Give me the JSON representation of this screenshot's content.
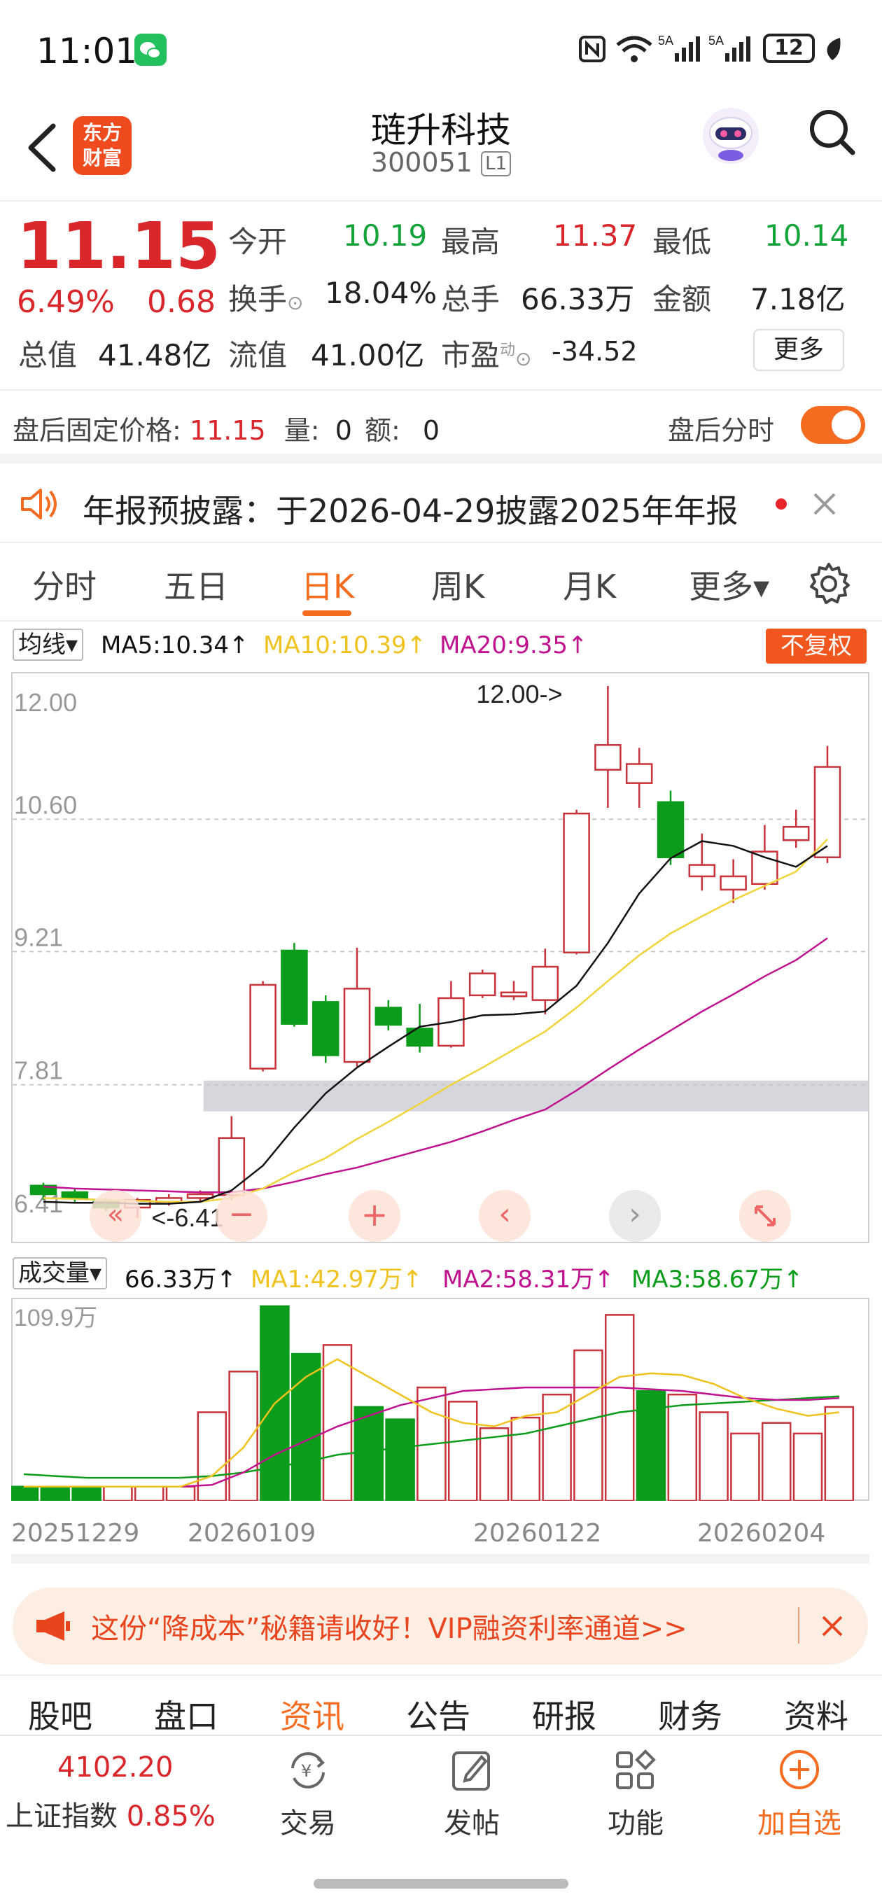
{
  "status_bar": {
    "time": "11:01",
    "battery": "12"
  },
  "header": {
    "title": "琏升科技",
    "code": "300051",
    "level": "L1",
    "logo_line1": "东方",
    "logo_line2": "财富"
  },
  "quote": {
    "price": "11.15",
    "change_pct": "6.49%",
    "change_amt": "0.68",
    "open_label": "今开",
    "open": "10.19",
    "high_label": "最高",
    "high": "11.37",
    "low_label": "最低",
    "low": "10.14",
    "turnover_label": "换手",
    "turnover": "18.04%",
    "volume_label": "总手",
    "volume": "66.33万",
    "amount_label": "金额",
    "amount": "7.18亿",
    "mktcap_label": "总值",
    "mktcap": "41.48亿",
    "float_label": "流值",
    "float_cap": "41.00亿",
    "pe_label": "市盈",
    "pe_sup": "动",
    "pe": "-34.52",
    "more_button": "更多"
  },
  "after_hours": {
    "label": "盘后固定价格:",
    "price": "11.15",
    "vol_label": "量:",
    "vol": "0",
    "amt_label": "额:",
    "amt": "0",
    "toggle_label": "盘后分时",
    "toggle_on": true
  },
  "notice": {
    "text": "年报预披露：于2026-04-29披露2025年年报"
  },
  "tabs": [
    "分时",
    "五日",
    "日K",
    "周K",
    "月K",
    "更多▾"
  ],
  "active_tab": "日K",
  "ma_legend": {
    "selector": "均线▾",
    "ma5": "MA5:10.34↑",
    "ma10": "MA10:10.39↑",
    "ma20": "MA20:9.35↑",
    "adjust_button": "不复权"
  },
  "vol_legend": {
    "selector": "成交量▾",
    "vol": "66.33万↑",
    "ma1": "MA1:42.97万↑",
    "ma2": "MA2:58.31万↑",
    "ma3": "MA3:58.67万↑"
  },
  "colors": {
    "up": "#c8323a",
    "down": "#0b9c1b",
    "ma5": "#111111",
    "ma10": "#f0d43a",
    "ma20": "#c0128e",
    "accent": "#f56b1f"
  },
  "chart_data": {
    "type": "candlestick",
    "y_ticks": [
      "12.00",
      "10.60",
      "9.21",
      "7.81",
      "6.41"
    ],
    "ylim": [
      6.41,
      12.0
    ],
    "annotations": {
      "high_mark": "12.00->",
      "low_mark": "<-6.41"
    },
    "candles": [
      {
        "o": 6.75,
        "c": 6.66,
        "h": 6.78,
        "l": 6.6
      },
      {
        "o": 6.68,
        "c": 6.62,
        "h": 6.72,
        "l": 6.58
      },
      {
        "o": 6.58,
        "c": 6.52,
        "h": 6.62,
        "l": 6.48
      },
      {
        "o": 6.52,
        "c": 6.6,
        "h": 6.62,
        "l": 6.41
      },
      {
        "o": 6.58,
        "c": 6.62,
        "h": 6.66,
        "l": 6.54
      },
      {
        "o": 6.62,
        "c": 6.66,
        "h": 6.7,
        "l": 6.58
      },
      {
        "o": 6.65,
        "c": 7.25,
        "h": 7.48,
        "l": 6.6
      },
      {
        "o": 7.98,
        "c": 8.86,
        "h": 8.9,
        "l": 7.95
      },
      {
        "o": 9.22,
        "c": 8.45,
        "h": 9.3,
        "l": 8.42
      },
      {
        "o": 8.68,
        "c": 8.12,
        "h": 8.75,
        "l": 8.04
      },
      {
        "o": 8.05,
        "c": 8.82,
        "h": 9.25,
        "l": 8.0
      },
      {
        "o": 8.62,
        "c": 8.44,
        "h": 8.7,
        "l": 8.38
      },
      {
        "o": 8.4,
        "c": 8.22,
        "h": 8.66,
        "l": 8.15
      },
      {
        "o": 8.22,
        "c": 8.72,
        "h": 8.9,
        "l": 8.2
      },
      {
        "o": 8.75,
        "c": 8.98,
        "h": 9.02,
        "l": 8.72
      },
      {
        "o": 8.74,
        "c": 8.78,
        "h": 8.9,
        "l": 8.7
      },
      {
        "o": 8.7,
        "c": 9.05,
        "h": 9.24,
        "l": 8.55
      },
      {
        "o": 9.2,
        "c": 10.66,
        "h": 10.7,
        "l": 9.18
      },
      {
        "o": 11.12,
        "c": 11.38,
        "h": 12.0,
        "l": 10.72
      },
      {
        "o": 10.98,
        "c": 11.18,
        "h": 11.35,
        "l": 10.72
      },
      {
        "o": 10.78,
        "c": 10.2,
        "h": 10.9,
        "l": 10.12
      },
      {
        "o": 10.0,
        "c": 10.12,
        "h": 10.45,
        "l": 9.85
      },
      {
        "o": 9.86,
        "c": 10.0,
        "h": 10.18,
        "l": 9.72
      },
      {
        "o": 9.92,
        "c": 10.26,
        "h": 10.54,
        "l": 9.86
      },
      {
        "o": 10.38,
        "c": 10.52,
        "h": 10.7,
        "l": 10.3
      },
      {
        "o": 10.2,
        "c": 11.15,
        "h": 11.37,
        "l": 10.14
      }
    ],
    "ma5": [
      6.58,
      6.57,
      6.57,
      6.56,
      6.56,
      6.58,
      6.7,
      6.96,
      7.36,
      7.72,
      7.99,
      8.21,
      8.42,
      8.47,
      8.54,
      8.55,
      8.58,
      8.85,
      9.3,
      9.82,
      10.19,
      10.37,
      10.32,
      10.2,
      10.1,
      10.32
    ],
    "ma10": [
      6.62,
      6.61,
      6.6,
      6.59,
      6.58,
      6.58,
      6.62,
      6.72,
      6.89,
      7.04,
      7.24,
      7.42,
      7.61,
      7.81,
      7.99,
      8.18,
      8.37,
      8.62,
      8.9,
      9.17,
      9.4,
      9.58,
      9.75,
      9.9,
      10.05,
      10.39
    ],
    "ma20": [
      6.74,
      6.72,
      6.71,
      6.7,
      6.69,
      6.68,
      6.68,
      6.72,
      6.79,
      6.87,
      6.94,
      7.03,
      7.12,
      7.21,
      7.32,
      7.44,
      7.55,
      7.75,
      7.97,
      8.18,
      8.38,
      8.58,
      8.76,
      8.95,
      9.12,
      9.35
    ],
    "volume": {
      "ytick": "109.9万",
      "values": [
        8,
        8,
        8,
        8,
        8,
        8,
        50,
        73,
        109.9,
        83,
        88,
        53,
        46,
        64,
        56,
        41,
        47,
        60,
        85,
        105,
        62,
        60,
        50,
        38,
        44,
        38,
        53
      ],
      "ma1": [
        8,
        8,
        8,
        8,
        8,
        8,
        14,
        30,
        55,
        70,
        80,
        70,
        60,
        50,
        44,
        42,
        48,
        50,
        60,
        70,
        72,
        71,
        66,
        58,
        52,
        48,
        50
      ],
      "ma2": [
        8,
        8,
        8,
        8,
        8,
        8,
        9,
        16,
        26,
        34,
        42,
        48,
        54,
        58,
        62,
        63,
        64,
        64,
        64,
        64,
        63,
        62,
        60,
        58,
        57,
        57,
        58
      ],
      "ma3": [
        15,
        14,
        13,
        13,
        13,
        13,
        14,
        16,
        19,
        22,
        26,
        28,
        30,
        32,
        34,
        36,
        38,
        42,
        46,
        50,
        52,
        54,
        55,
        56,
        57,
        58,
        59
      ]
    },
    "x_labels": [
      "20251229",
      "20260109",
      "20260122",
      "20260204"
    ]
  },
  "ad": {
    "text": "这份“降成本”秘籍请收好！VIP融资利率通道>>"
  },
  "sub_tabs": [
    "股吧",
    "盘口",
    "资讯",
    "公告",
    "研报",
    "财务",
    "资料"
  ],
  "active_sub_tab": "资讯",
  "bottom": {
    "index_value": "4102.20",
    "index_name": "上证指数",
    "index_change": "0.85%",
    "nav": [
      "交易",
      "发帖",
      "功能",
      "加自选"
    ]
  }
}
